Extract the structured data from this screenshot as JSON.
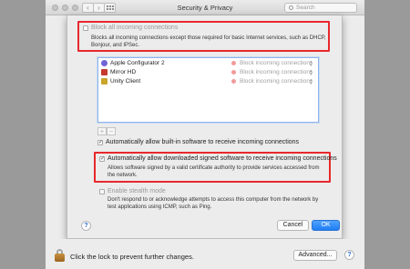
{
  "window": {
    "title": "Security & Privacy",
    "search_placeholder": "Search"
  },
  "block_all": {
    "label": "Block all incoming connections",
    "description": "Blocks all incoming connections except those required for basic Internet services, such as DHCP, Bonjour, and IPSec.",
    "checked": false
  },
  "apps": [
    {
      "name": "Apple Configurator 2",
      "status": "Block incoming connections",
      "icon": "apple-configurator-icon",
      "color": "#6f63d6"
    },
    {
      "name": "Mirror HD",
      "status": "Block incoming connections",
      "icon": "mirror-hd-icon",
      "color": "#c63a2e"
    },
    {
      "name": "Unity Client",
      "status": "Block incoming connections",
      "icon": "unity-client-icon",
      "color": "#caa52b"
    }
  ],
  "list_controls": {
    "add": "+",
    "remove": "−"
  },
  "auto_builtin": {
    "label": "Automatically allow built-in software to receive incoming connections",
    "checked": true
  },
  "auto_signed": {
    "label": "Automatically allow downloaded signed software to receive incoming connections",
    "description": "Allows software signed by a valid certificate authority to provide services accessed from the network.",
    "checked": true
  },
  "stealth": {
    "label": "Enable stealth mode",
    "description": "Don't respond to or acknowledge attempts to access this computer from the network by test applications using ICMP, such as Ping.",
    "checked": false
  },
  "buttons": {
    "help": "?",
    "cancel": "Cancel",
    "ok": "OK",
    "advanced": "Advanced..."
  },
  "bottom": {
    "lock_text": "Click the lock to prevent further changes."
  },
  "colors": {
    "accent": "#1f7ef5",
    "highlight": "#e8282b"
  }
}
